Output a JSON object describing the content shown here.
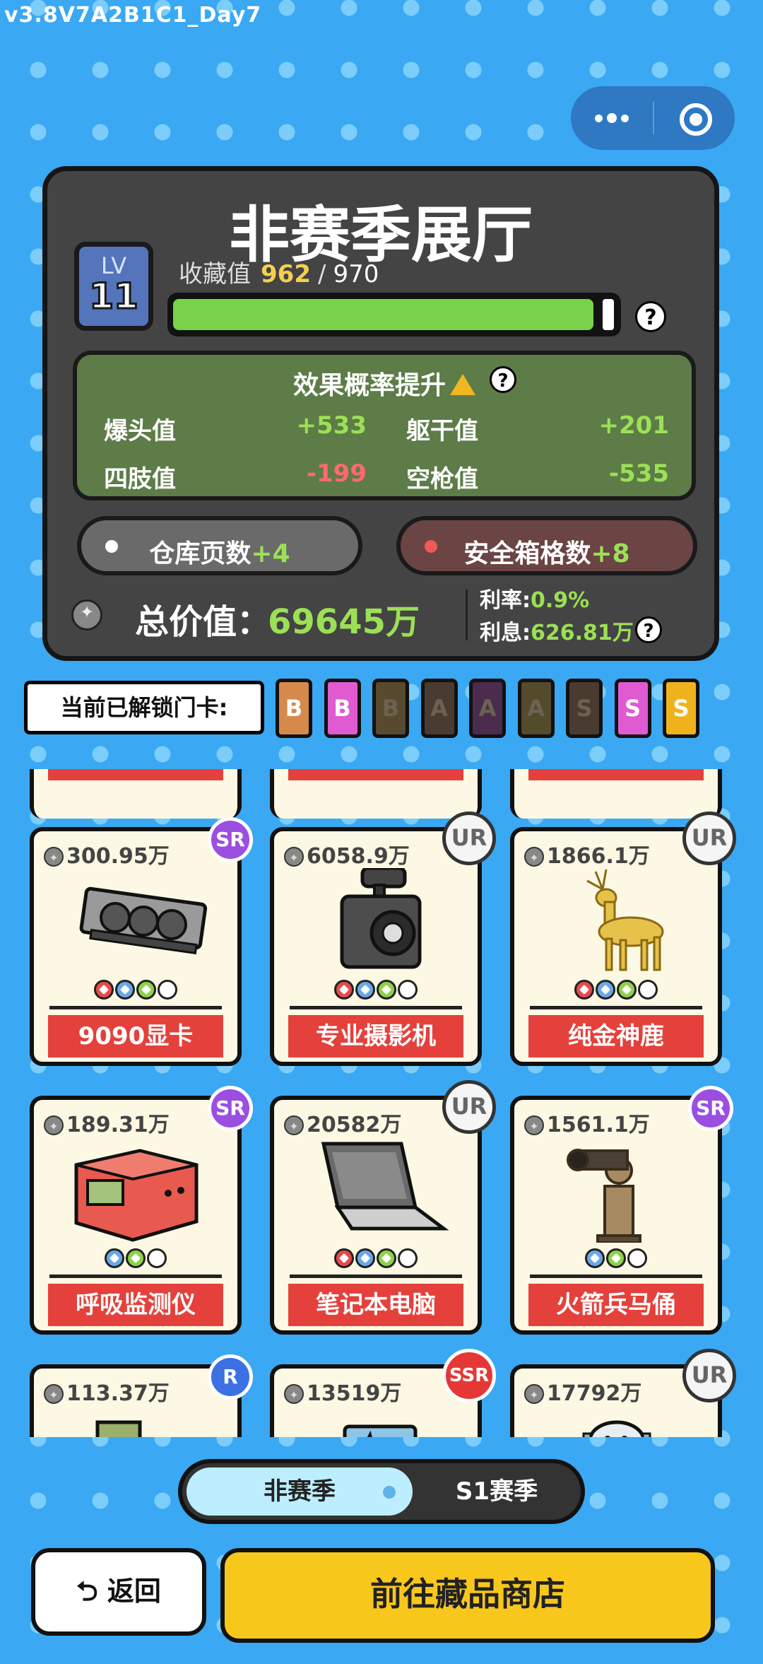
{
  "version": "v3.8V7A2B1C1_Day7",
  "hall": {
    "title": "非赛季展厅",
    "level_label": "LV",
    "level": "11",
    "collection_label": "收藏值",
    "collection_current": "962",
    "collection_sep": "/",
    "collection_max": "970",
    "collection_progress": 0.992
  },
  "effects": {
    "title": "效果概率提升",
    "stats": [
      {
        "label": "爆头值",
        "value": "+533"
      },
      {
        "label": "躯干值",
        "value": "+201"
      },
      {
        "label": "四肢值",
        "value": "-199"
      },
      {
        "label": "空枪值",
        "value": "-535"
      }
    ]
  },
  "bonuses": [
    {
      "label": "仓库页数",
      "value": "+4"
    },
    {
      "label": "安全箱格数",
      "value": "+8"
    }
  ],
  "total": {
    "label": "总价值：",
    "value": "69645万"
  },
  "interest": {
    "rate_label": "利率:",
    "rate": "0.9%",
    "interest_label": "利息:",
    "interest": "626.81万"
  },
  "unlock": {
    "label": "当前已解锁门卡:",
    "cards": [
      {
        "letter": "B",
        "color": "#d58a4c",
        "unlocked": true
      },
      {
        "letter": "B",
        "color": "#e05ad2",
        "unlocked": true
      },
      {
        "letter": "B",
        "color": "#574a2e",
        "unlocked": false
      },
      {
        "letter": "A",
        "color": "#4a3b30",
        "unlocked": false
      },
      {
        "letter": "A",
        "color": "#4b2b4e",
        "unlocked": false
      },
      {
        "letter": "A",
        "color": "#544a2c",
        "unlocked": false
      },
      {
        "letter": "S",
        "color": "#4a3b30",
        "unlocked": false
      },
      {
        "letter": "S",
        "color": "#e05ad2",
        "unlocked": true
      },
      {
        "letter": "S",
        "color": "#f0b21c",
        "unlocked": true
      }
    ]
  },
  "items": [
    {
      "price": "300.95万",
      "name": "9090显卡",
      "rarity": "SR",
      "icon": "graphics-card-icon",
      "gems": [
        "#e84a4a",
        "#6aa8e8",
        "#8fd148",
        "#ffffff"
      ]
    },
    {
      "price": "6058.9万",
      "name": "专业摄影机",
      "rarity": "UR",
      "icon": "camera-icon",
      "gems": [
        "#e84a4a",
        "#6aa8e8",
        "#8fd148",
        "#ffffff"
      ]
    },
    {
      "price": "1866.1万",
      "name": "纯金神鹿",
      "rarity": "UR",
      "icon": "golden-deer-icon",
      "gems": [
        "#e84a4a",
        "#6aa8e8",
        "#8fd148",
        "#ffffff"
      ]
    },
    {
      "price": "189.31万",
      "name": "呼吸监测仪",
      "rarity": "SR",
      "icon": "breath-monitor-icon",
      "gems": [
        "#6aa8e8",
        "#8fd148",
        "#ffffff"
      ]
    },
    {
      "price": "20582万",
      "name": "笔记本电脑",
      "rarity": "UR",
      "icon": "laptop-icon",
      "gems": [
        "#e84a4a",
        "#6aa8e8",
        "#8fd148",
        "#ffffff"
      ]
    },
    {
      "price": "1561.1万",
      "name": "火箭兵马俑",
      "rarity": "SR",
      "icon": "terracotta-warrior-icon",
      "gems": [
        "#6aa8e8",
        "#8fd148",
        "#ffffff"
      ]
    },
    {
      "price": "113.37万",
      "name": "",
      "rarity": "R",
      "icon": "device-icon",
      "gems": []
    },
    {
      "price": "13519万",
      "name": "",
      "rarity": "SSR",
      "icon": "tag-icon",
      "gems": []
    },
    {
      "price": "17792万",
      "name": "",
      "rarity": "UR",
      "icon": "robot-icon",
      "gems": []
    }
  ],
  "season_toggle": {
    "active": "非赛季",
    "other": "S1赛季"
  },
  "buttons": {
    "back": "返回",
    "shop": "前往藏品商店"
  }
}
